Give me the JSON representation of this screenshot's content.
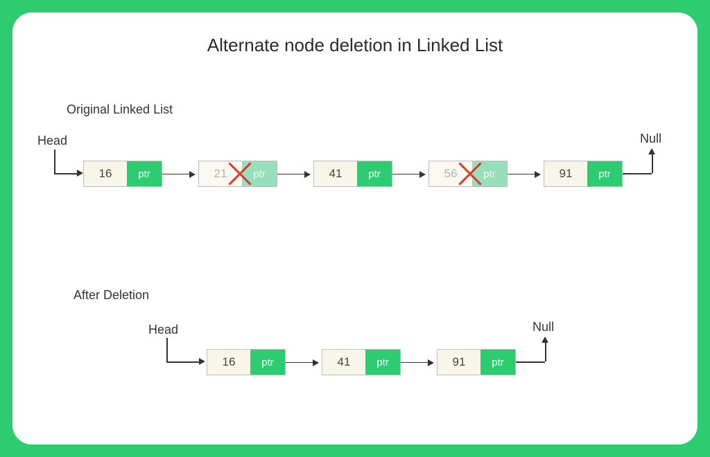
{
  "title": "Alternate node deletion in Linked List",
  "labels": {
    "original": "Original Linked List",
    "after": "After  Deletion",
    "head": "Head",
    "null": "Null",
    "ptr": "ptr"
  },
  "original_nodes": [
    {
      "value": "16",
      "deleted": false
    },
    {
      "value": "21",
      "deleted": true
    },
    {
      "value": "41",
      "deleted": false
    },
    {
      "value": "56",
      "deleted": true
    },
    {
      "value": "91",
      "deleted": false
    }
  ],
  "after_nodes": [
    {
      "value": "16"
    },
    {
      "value": "41"
    },
    {
      "value": "91"
    }
  ],
  "colors": {
    "accent": "#2ECC71",
    "node_bg": "#F7F6E8",
    "cross": "#d83a2b"
  }
}
